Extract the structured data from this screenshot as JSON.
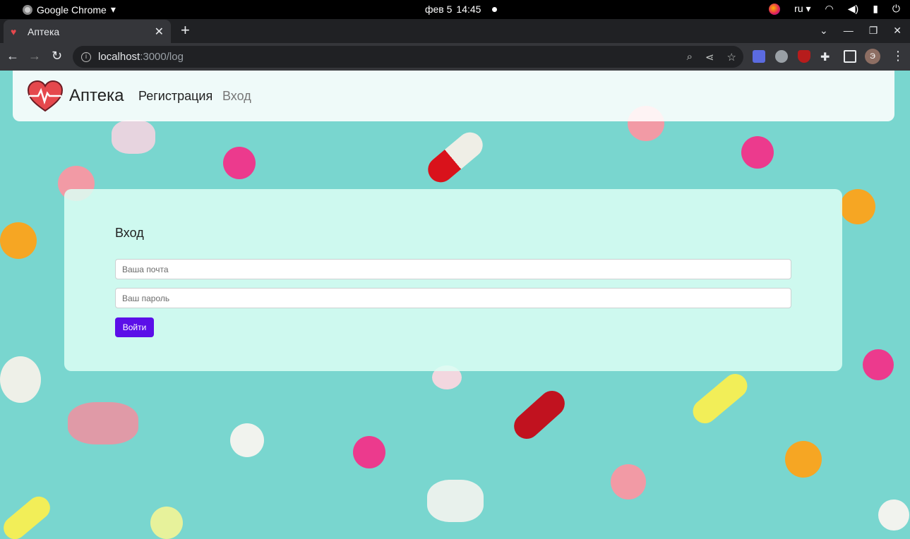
{
  "os": {
    "app_name": "Google Chrome",
    "date": "фев 5",
    "time": "14:45",
    "lang": "ru"
  },
  "browser": {
    "tab_title": "Аптека",
    "url_host": "localhost",
    "url_path": ":3000/log",
    "avatar_letter": "Э"
  },
  "navbar": {
    "brand": "Аптека",
    "links": [
      {
        "label": "Регистрация",
        "active": false
      },
      {
        "label": "Вход",
        "active": true
      }
    ]
  },
  "login": {
    "title": "Вход",
    "email_placeholder": "Ваша почта",
    "password_placeholder": "Ваш пароль",
    "submit_label": "Войти"
  },
  "colors": {
    "primary_button": "#5b0fe8",
    "background": "#79d6cf",
    "logo_heart": "#e5484d"
  }
}
